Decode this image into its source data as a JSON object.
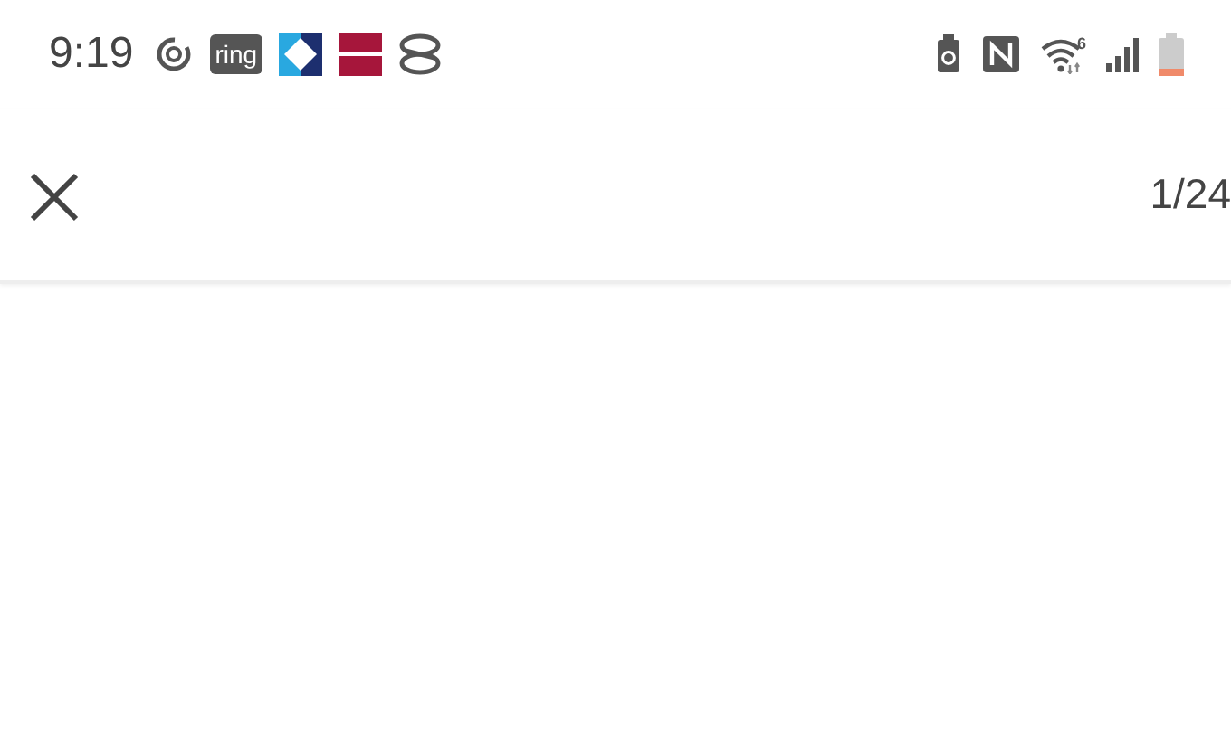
{
  "status_bar": {
    "time": "9:19",
    "notification_icons": [
      {
        "kind": "sync"
      },
      {
        "kind": "ring",
        "label": "ring"
      },
      {
        "kind": "diamond"
      },
      {
        "kind": "flag"
      },
      {
        "kind": "coin"
      }
    ],
    "wifi_badge": "6"
  },
  "toolbar": {
    "counter": "1/24"
  }
}
